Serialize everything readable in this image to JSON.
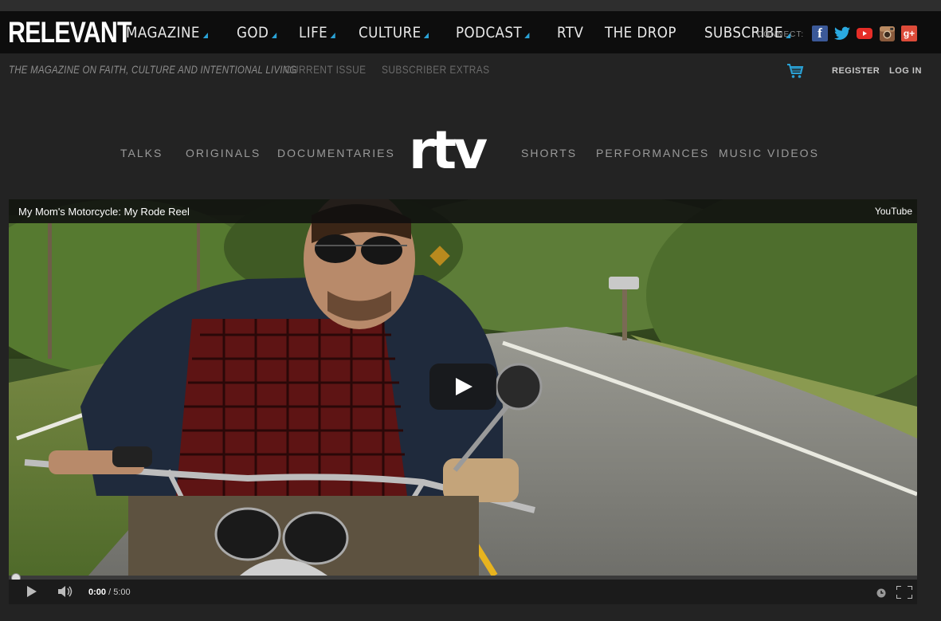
{
  "site": {
    "logo": "RELEVANT",
    "nav": [
      {
        "label": "MAGAZINE",
        "dropdown": true
      },
      {
        "label": "GOD",
        "dropdown": true
      },
      {
        "label": "LIFE",
        "dropdown": true
      },
      {
        "label": "CULTURE",
        "dropdown": true
      },
      {
        "label": "PODCAST",
        "dropdown": true
      },
      {
        "label": "RTV",
        "dropdown": false
      },
      {
        "label": "THE DROP",
        "dropdown": false
      },
      {
        "label": "SUBSCRIBE",
        "dropdown": true
      }
    ],
    "connect_label": "CONNECT:",
    "social": [
      {
        "name": "facebook-icon",
        "glyph": "f",
        "color": "#3b5998"
      },
      {
        "name": "twitter-icon",
        "glyph": "t",
        "color": "#1da1f2"
      },
      {
        "name": "youtube-icon",
        "glyph": "▶",
        "color": "#e52d27"
      },
      {
        "name": "instagram-icon",
        "glyph": "◎",
        "color": "#8a5a3c"
      },
      {
        "name": "google-plus-icon",
        "glyph": "g+",
        "color": "#dd4b39"
      }
    ],
    "accent_color": "#2aa2d6"
  },
  "subnav": {
    "tagline": "THE MAGAZINE ON FAITH, CULTURE AND INTENTIONAL LIVING",
    "links": [
      "CURRENT ISSUE",
      "SUBSCRIBER EXTRAS"
    ],
    "register": "REGISTER",
    "login": "LOG IN"
  },
  "rtv": {
    "logo": "rtv",
    "left_items": [
      "TALKS",
      "ORIGINALS",
      "DOCUMENTARIES"
    ],
    "right_items": [
      "SHORTS",
      "PERFORMANCES",
      "MUSIC VIDEOS"
    ]
  },
  "video": {
    "title": "My Mom's Motorcycle: My Rode Reel",
    "source": "YouTube",
    "current_time": "0:00",
    "duration": "/ 5:00",
    "progress": 0
  }
}
